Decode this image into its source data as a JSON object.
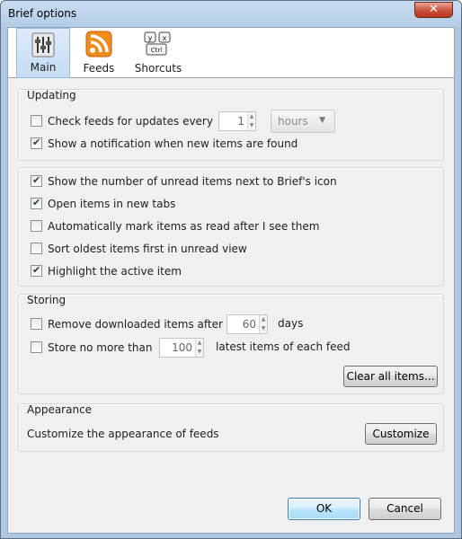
{
  "window": {
    "title": "Brief options",
    "close_glyph": "✕"
  },
  "tabs": [
    {
      "label": "Main",
      "icon": "sliders-icon",
      "selected": true
    },
    {
      "label": "Feeds",
      "icon": "rss-feed-icon",
      "selected": false
    },
    {
      "label": "Shorcuts",
      "icon": "keyboard-keys-icon",
      "selected": false
    }
  ],
  "icon_text": {
    "key1": "y",
    "key2": "x",
    "key3": "Ctrl"
  },
  "updating": {
    "legend": "Updating",
    "check_feeds": {
      "label": "Check feeds for updates every",
      "checked": false
    },
    "interval_value": "1",
    "interval_unit": "hours",
    "notify": {
      "label": "Show a notification when new items are found",
      "checked": true
    }
  },
  "display": {
    "options": [
      {
        "label": "Show the number of unread items next to Brief's icon",
        "checked": true
      },
      {
        "label": "Open items in new tabs",
        "checked": true
      },
      {
        "label": "Automatically mark items as read after I see them",
        "checked": false
      },
      {
        "label": "Sort oldest items first in unread view",
        "checked": false
      },
      {
        "label": "Highlight the active item",
        "checked": true
      }
    ]
  },
  "storing": {
    "legend": "Storing",
    "remove": {
      "label": "Remove downloaded items after",
      "checked": false,
      "value": "60",
      "unit": "days"
    },
    "limit": {
      "label": "Store no more than",
      "checked": false,
      "value": "100",
      "unit": "latest items of each feed"
    },
    "clear_label": "Clear all items..."
  },
  "appearance": {
    "legend": "Appearance",
    "text": "Customize the appearance of feeds",
    "customize_label": "Customize"
  },
  "buttons": {
    "ok": "OK",
    "cancel": "Cancel"
  },
  "colors": {
    "titlebar": "#b3cde6",
    "default_button": "#3c7fb1",
    "rss_orange": "#f08c1e"
  }
}
